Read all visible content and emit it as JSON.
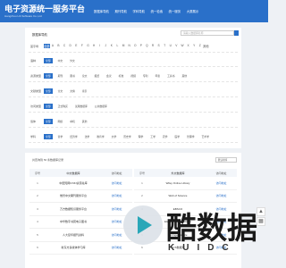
{
  "header": {
    "logo_title": "电子资源统一服务平台",
    "logo_subtitle": "Hangzhou Lib Software Co.,Ltd",
    "nav": [
      "数据库导航",
      "期刊导航",
      "学科导航",
      "统一检索",
      "统一服务",
      "大屏展示"
    ]
  },
  "filters": {
    "title": "数据库导航",
    "search_placeholder": "请输入数据库名称",
    "letter_label": "首字母",
    "letters": [
      "全部",
      "A",
      "B",
      "C",
      "D",
      "E",
      "F",
      "G",
      "H",
      "I",
      "J",
      "K",
      "L",
      "M",
      "N",
      "O",
      "P",
      "Q",
      "R",
      "S",
      "T",
      "U",
      "V",
      "W",
      "X",
      "Y",
      "Z",
      "其他"
    ],
    "rows": [
      {
        "label": "语种",
        "chips": [
          "全部",
          "中文",
          "外文"
        ]
      },
      {
        "label": "资源类型",
        "chips": [
          "全部",
          "期刊",
          "图书",
          "论文",
          "报纸",
          "会议",
          "标准",
          "视频",
          "专利",
          "年鉴",
          "工具书",
          "其他"
        ]
      },
      {
        "label": "文献类型",
        "chips": [
          "全部",
          "全文",
          "文摘",
          "索引"
        ]
      },
      {
        "label": "访问类型",
        "chips": [
          "全部",
          "正式购买",
          "试用数据库",
          "公共数据库"
        ]
      },
      {
        "label": "载体",
        "chips": [
          "全部",
          "网络",
          "单机",
          "其他"
        ]
      },
      {
        "label": "学科",
        "chips": [
          "全部",
          "哲学",
          "经济学",
          "法学",
          "教育学",
          "文学",
          "历史学",
          "理学",
          "工学",
          "农学",
          "医学",
          "管理学",
          "艺术学"
        ]
      }
    ],
    "more": "更多"
  },
  "results": {
    "summary": "共查询到 56 条数据库记录",
    "sort": "默认排序",
    "col_no": "序号",
    "col_name": "中文数据库",
    "col_name_right": "外文数据库",
    "col_link": "访问地址",
    "link_text": "访问地址",
    "left_rows": [
      {
        "no": "1",
        "name": "中国知网CNKI资源总库"
      },
      {
        "no": "2",
        "name": "维普中文期刊服务平台"
      },
      {
        "no": "3",
        "name": "万方数据知识服务平台"
      },
      {
        "no": "4",
        "name": "中华数字书苑电子图书"
      },
      {
        "no": "5",
        "name": "人大复印报刊资料"
      },
      {
        "no": "6",
        "name": "新东方多媒体学习库"
      }
    ],
    "right_rows": [
      {
        "no": "1",
        "name": "Wiley Online Library"
      },
      {
        "no": "2",
        "name": "Web of Science"
      },
      {
        "no": "3",
        "name": "EBSCO"
      },
      {
        "no": "4",
        "name": "Elsevier ScienceDirect"
      },
      {
        "no": "5",
        "name": "Springer Nature"
      },
      {
        "no": "6",
        "name": "ACS数据库"
      }
    ]
  },
  "watermark": {
    "text": "酷数据",
    "sub": "KUIDC"
  },
  "colors": {
    "accent": "#2a70c9",
    "watermark_play": "#2aa7b8"
  }
}
